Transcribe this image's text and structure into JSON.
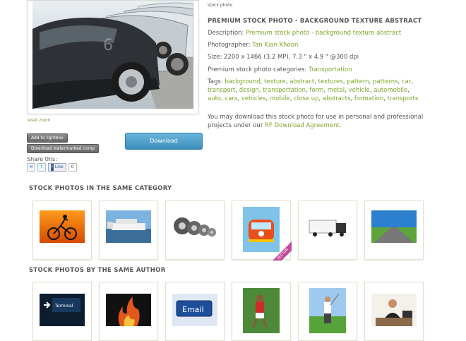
{
  "photo": {
    "reset_zoom": "reset zoom",
    "add_to_lightbox": "Add to lightbox",
    "download_watermarked": "Download watermarked comp",
    "download": "Download",
    "share_label": "Share this:",
    "fb_like": "Like",
    "fb_count": "0"
  },
  "info": {
    "caption": "stock photo",
    "title": "PREMIUM STOCK PHOTO - BACKGROUND TEXTURE ABSTRACT",
    "description_label": "Description:",
    "description_value": "Premium stock photo - background texture abstract",
    "photographer_label": "Photographer:",
    "photographer_value": "Tan Kian Khoon",
    "size_label": "Size:",
    "size_value": "2200 x 1466 (3.2 MP), 7.3 \" x 4.9 \" @300 dpi",
    "categories_label": "Premium stock photo categories:",
    "categories_value": "Transportation",
    "tags_label": "Tags:",
    "tags": [
      "background",
      "texture",
      "abstract",
      "textures",
      "pattern",
      "patterns",
      "car",
      "transport",
      "design",
      "transportation",
      "form",
      "metal",
      "vehicle",
      "automobile",
      "auto",
      "cars",
      "vehicles",
      "mobile",
      "close up",
      "abstracts",
      "formation",
      "transports"
    ],
    "license_text": "You may download this stock photo for use in personal and professional projects under our",
    "license_link": "RF Download Agreement",
    "license_end": "."
  },
  "sections": {
    "same_category": "STOCK PHOTOS IN THE SAME CATEGORY",
    "same_author": "STOCK PHOTOS BY THE SAME AUTHOR",
    "vector_badge": "VECTOR",
    "email_key": "Email"
  },
  "colors": {
    "link_green": "#7ea52a",
    "download_blue": "#4a9fcc",
    "vector_pink": "#c24a9a"
  }
}
